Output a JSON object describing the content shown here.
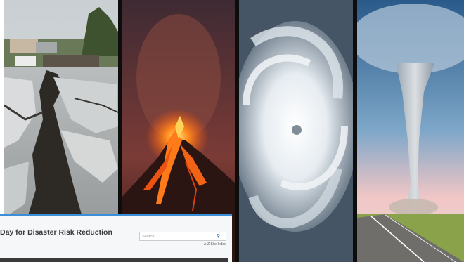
{
  "panels": [
    {
      "subject": "earthquake",
      "index": 1
    },
    {
      "subject": "volcano",
      "index": 2
    },
    {
      "subject": "hurricane",
      "index": 3
    },
    {
      "subject": "tornado",
      "index": 4
    }
  ],
  "website": {
    "title": "Day for Disaster Risk Reduction",
    "search_placeholder": "Search",
    "search_icon": "search-icon",
    "index_link": "A-Z Site Index",
    "accent_color": "#3a8fd8"
  }
}
